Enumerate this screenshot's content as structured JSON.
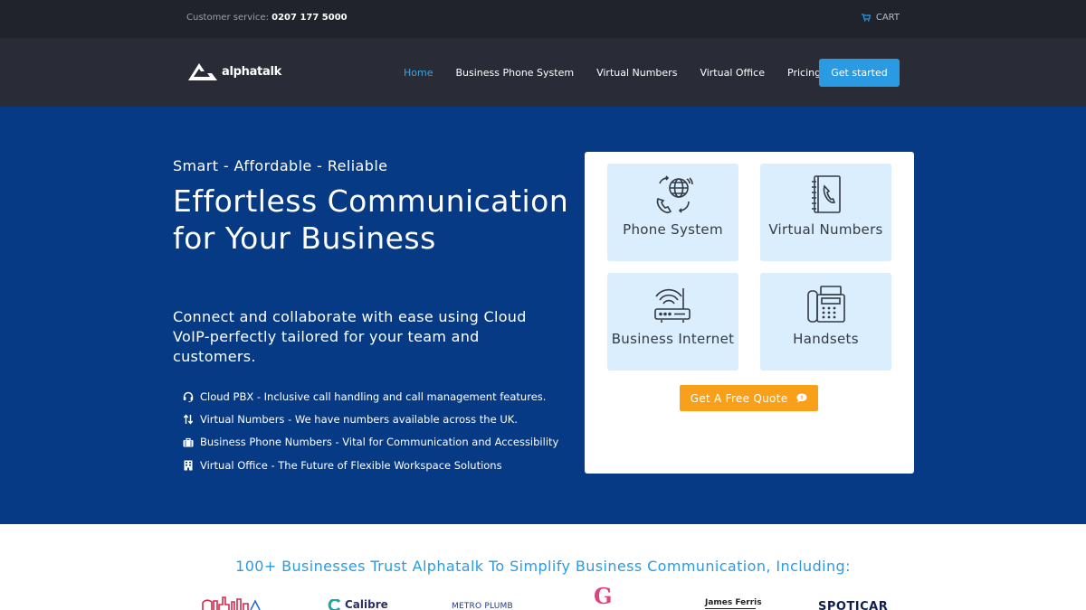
{
  "topbar": {
    "service_label": "Customer service:",
    "service_phone": "0207 177 5000",
    "cart_label": "CART"
  },
  "nav": {
    "logo_text": "alphatalk",
    "items": [
      {
        "label": "Home",
        "active": true
      },
      {
        "label": "Business Phone System"
      },
      {
        "label": "Virtual Numbers"
      },
      {
        "label": "Virtual Office"
      },
      {
        "label": "Pricing"
      }
    ],
    "cta_label": "Get started"
  },
  "hero": {
    "tagline": "Smart - Affordable - Reliable",
    "headline": "Effortless Communication for Your Business",
    "subtext": "Connect and collaborate with ease using Cloud VoIP-perfectly tailored for your team and customers.",
    "features": [
      {
        "icon": "headset-icon",
        "text": "Cloud PBX - Inclusive call handling and call management features."
      },
      {
        "icon": "sort-arrows-icon",
        "text": "Virtual Numbers - We have numbers available across the UK."
      },
      {
        "icon": "briefcase-icon",
        "text": "Business Phone Numbers - Vital for Communication and Accessibility"
      },
      {
        "icon": "building-icon",
        "text": "Virtual Office - The Future of Flexible Workspace Solutions"
      }
    ]
  },
  "services": {
    "tiles": [
      {
        "icon": "phone-globe-icon",
        "label": "Phone System"
      },
      {
        "icon": "phone-book-icon",
        "label": "Virtual Numbers"
      },
      {
        "icon": "router-icon",
        "label": "Business Internet"
      },
      {
        "icon": "desk-phone-icon",
        "label": "Handsets"
      }
    ],
    "quote_label": "Get A Free Quote"
  },
  "trust": {
    "heading": "100+ Businesses Trust Alphatalk To Simplify Business Communication, Including:",
    "logos": [
      "skyline-logo",
      "Calibre",
      "METRO PLUMB",
      "G",
      "James Ferris",
      "SPOTICAR"
    ]
  },
  "colors": {
    "topbar_bg": "#20232c",
    "nav_bg": "#292c37",
    "hero_bg": "#063a84",
    "accent": "#2a9be3",
    "quote": "#f9a01b",
    "tile_bg": "#daeefd"
  }
}
